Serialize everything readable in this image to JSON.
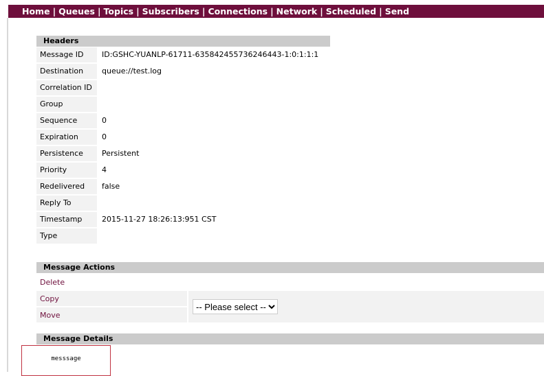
{
  "nav": [
    "Home",
    "Queues",
    "Topics",
    "Subscribers",
    "Connections",
    "Network",
    "Scheduled",
    "Send"
  ],
  "headers": {
    "title": "Headers",
    "rows": [
      {
        "label": "Message ID",
        "value": "ID:GSHC-YUANLP-61711-635842455736246443-1:0:1:1:1"
      },
      {
        "label": "Destination",
        "value": "queue://test.log"
      },
      {
        "label": "Correlation ID",
        "value": ""
      },
      {
        "label": "Group",
        "value": ""
      },
      {
        "label": "Sequence",
        "value": "0"
      },
      {
        "label": "Expiration",
        "value": "0"
      },
      {
        "label": "Persistence",
        "value": "Persistent"
      },
      {
        "label": "Priority",
        "value": "4"
      },
      {
        "label": "Redelivered",
        "value": "false"
      },
      {
        "label": "Reply To",
        "value": ""
      },
      {
        "label": "Timestamp",
        "value": "2015-11-27 18:26:13:951 CST"
      },
      {
        "label": "Type",
        "value": ""
      }
    ]
  },
  "actions": {
    "title": "Message Actions",
    "delete": "Delete",
    "copy": "Copy",
    "move": "Move",
    "select": "-- Please select --"
  },
  "details": {
    "title": "Message Details",
    "body": "messsage"
  },
  "colors": {
    "nav": "#6e0f3c",
    "header": "#cbcbcb",
    "label_bg": "#f2f2f2"
  }
}
